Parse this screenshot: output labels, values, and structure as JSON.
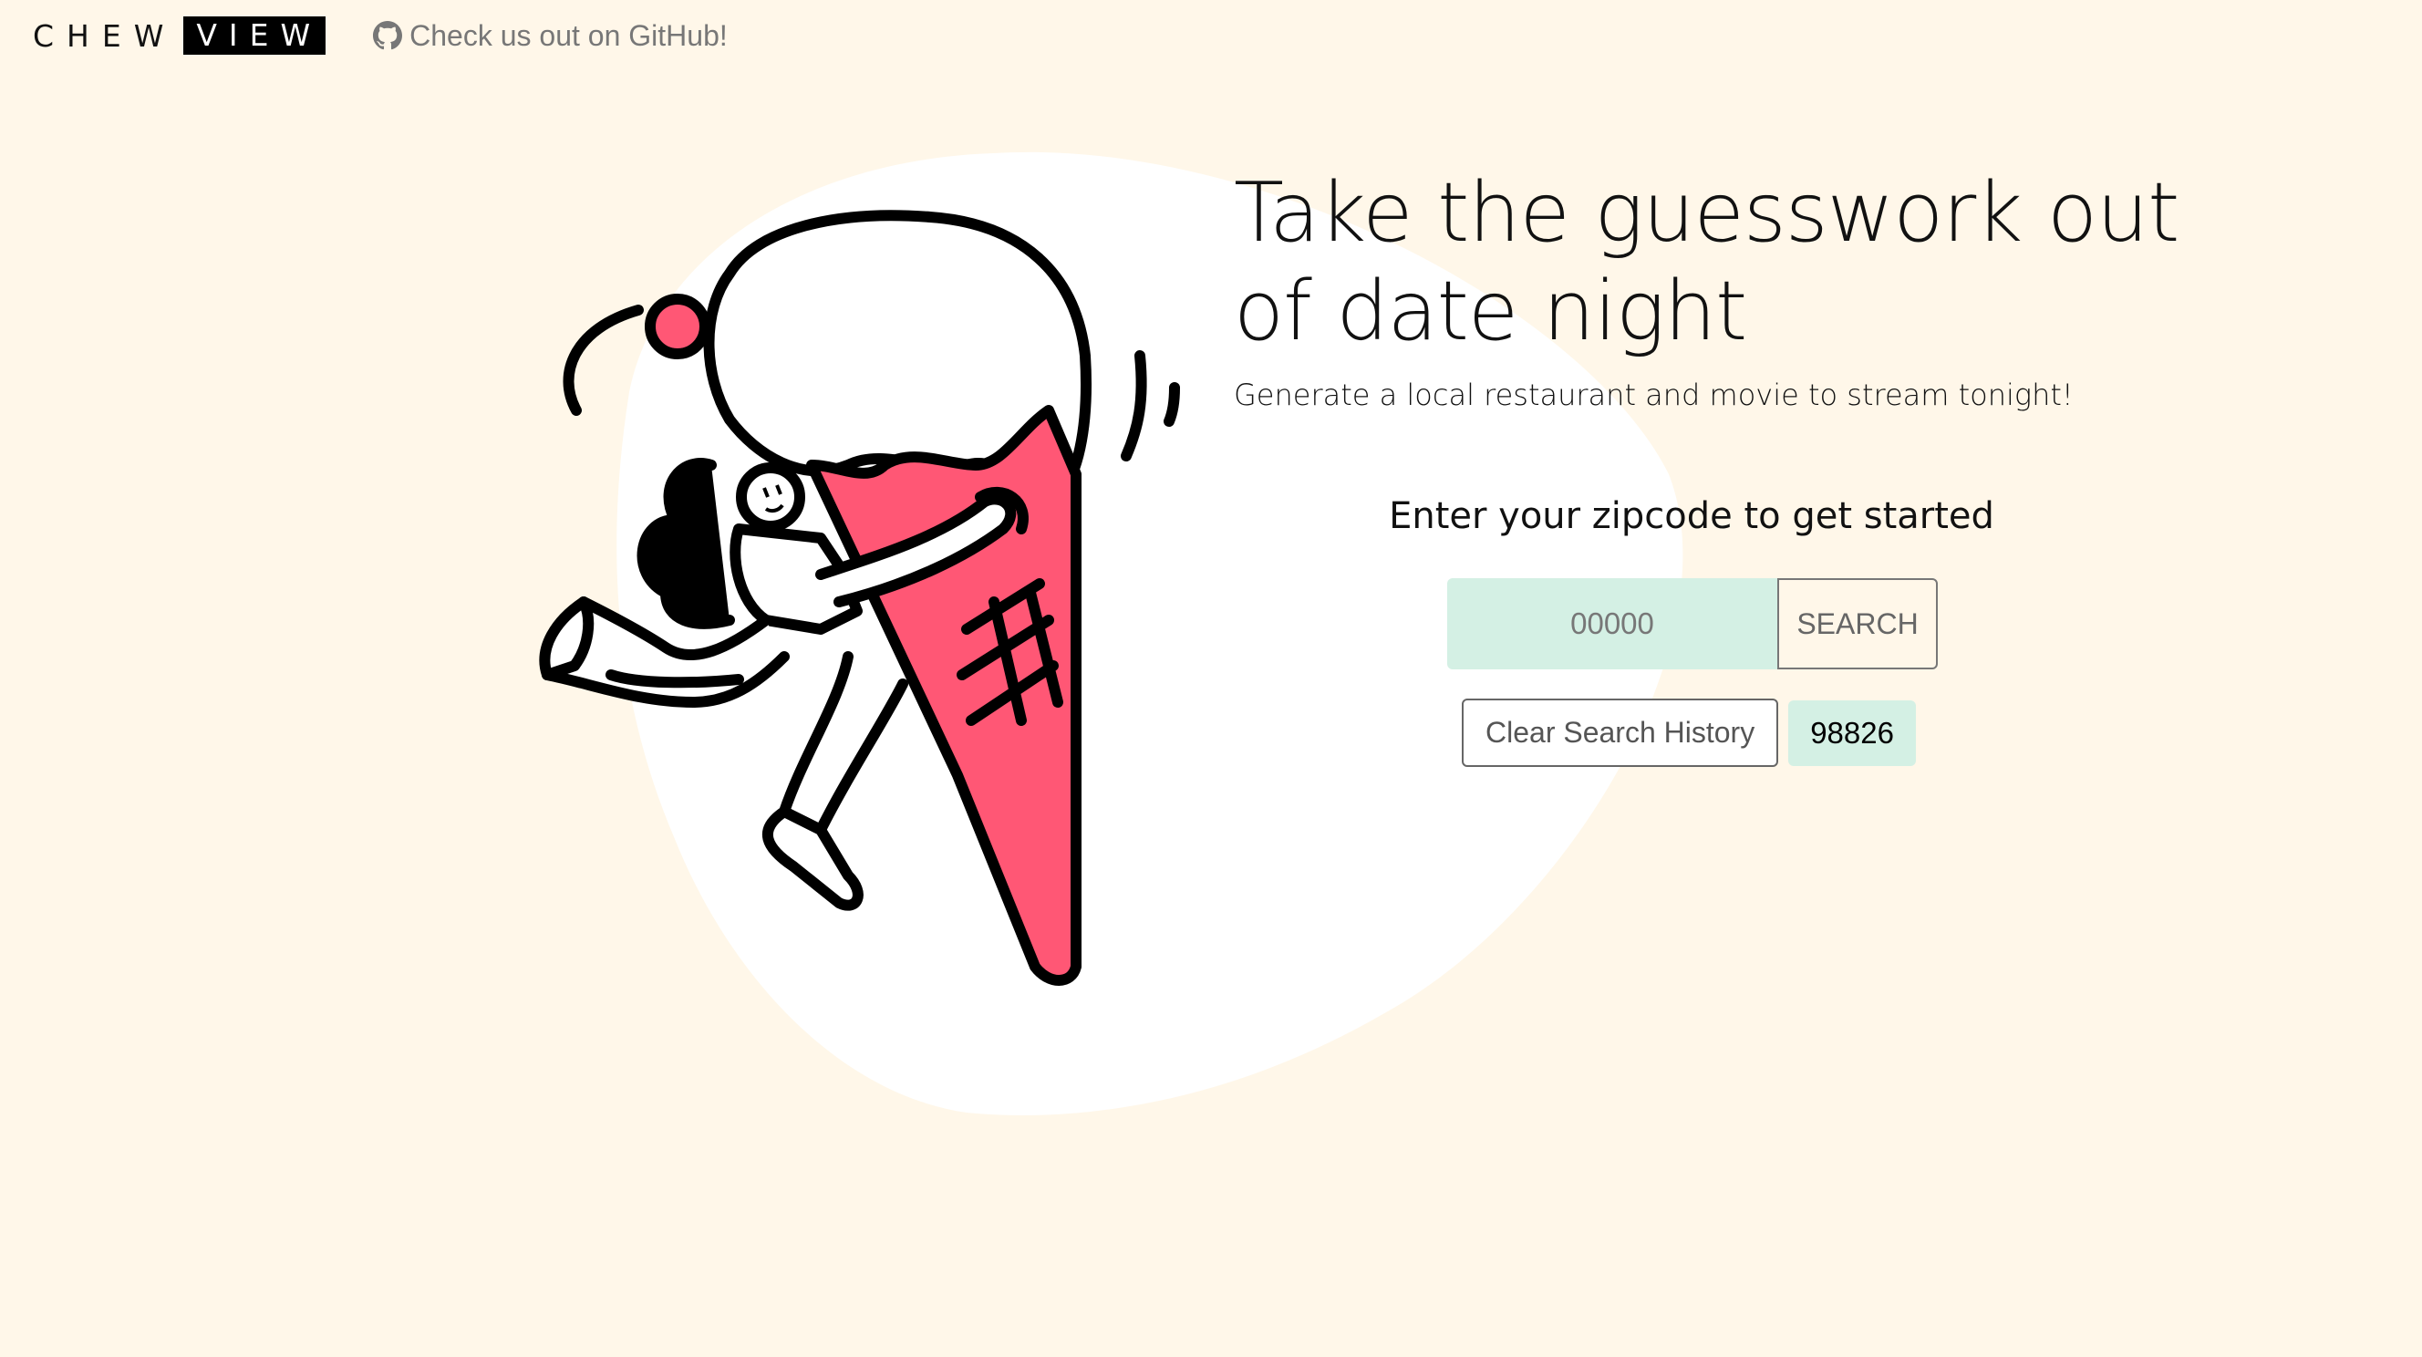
{
  "navbar": {
    "brand_part1": "CHEW",
    "brand_part2": "VIEW",
    "github_link_text": "Check us out on GitHub!"
  },
  "hero": {
    "title_line1": "Take the guesswork out",
    "title_line2": "of date night",
    "subtitle": "Generate a local restaurant and movie to stream tonight!"
  },
  "search": {
    "prompt": "Enter your zipcode to get started",
    "input_placeholder": "00000",
    "input_value": "",
    "search_button_label": "SEARCH",
    "clear_history_label": "Clear Search History",
    "history": [
      "98826"
    ]
  },
  "illustration": {
    "name": "girl-hugging-ice-cream-cone",
    "cone_color": "#ff5775",
    "cream_color": "#ffffff"
  },
  "colors": {
    "background": "#fff7e9",
    "accent_mint": "#d4f0e4",
    "accent_pink": "#ff5775"
  }
}
